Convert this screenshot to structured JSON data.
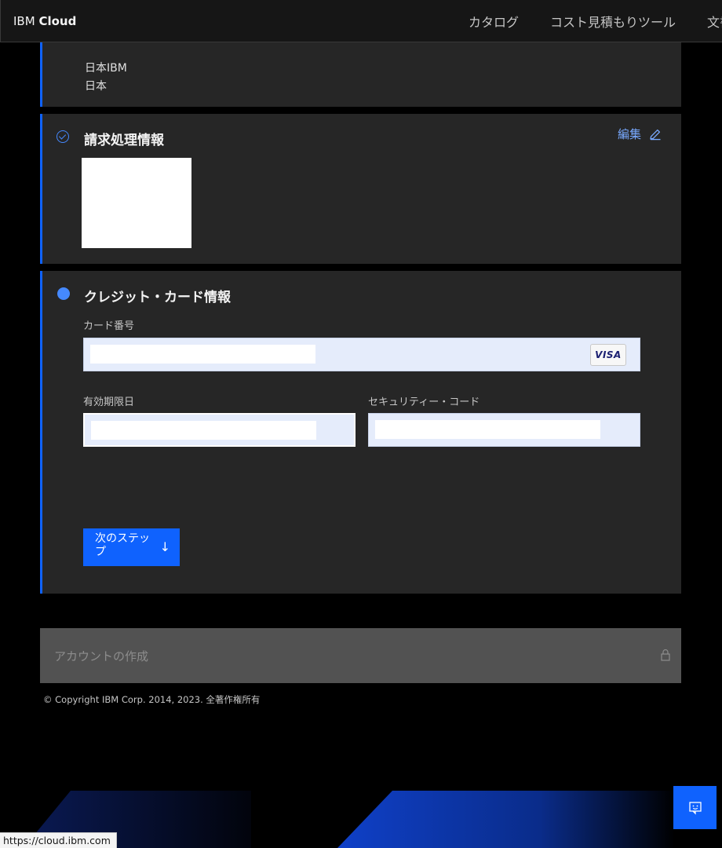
{
  "header": {
    "brand_prefix": "IBM",
    "brand_bold": "Cloud",
    "nav": [
      "カタログ",
      "コスト見積もりツール",
      "文書"
    ]
  },
  "address": {
    "line1": "日本IBM",
    "line2": "日本"
  },
  "billing": {
    "title": "請求処理情報",
    "edit_label": "編集"
  },
  "card": {
    "title": "クレジット・カード情報",
    "number_label": "カード番号",
    "expiry_label": "有効期限日",
    "security_label": "セキュリティー・コード",
    "brand_badge": "VISA",
    "next_button": "次のステップ"
  },
  "account": {
    "label": "アカウントの作成"
  },
  "footer": {
    "copyright": "© Copyright IBM Corp. 2014, 2023. 全著作権所有"
  },
  "status_bar": {
    "url": "https://cloud.ibm.com"
  },
  "colors": {
    "accent": "#0f62fe",
    "step_active": "#4589ff",
    "link": "#78a9ff",
    "panel": "#262626"
  }
}
